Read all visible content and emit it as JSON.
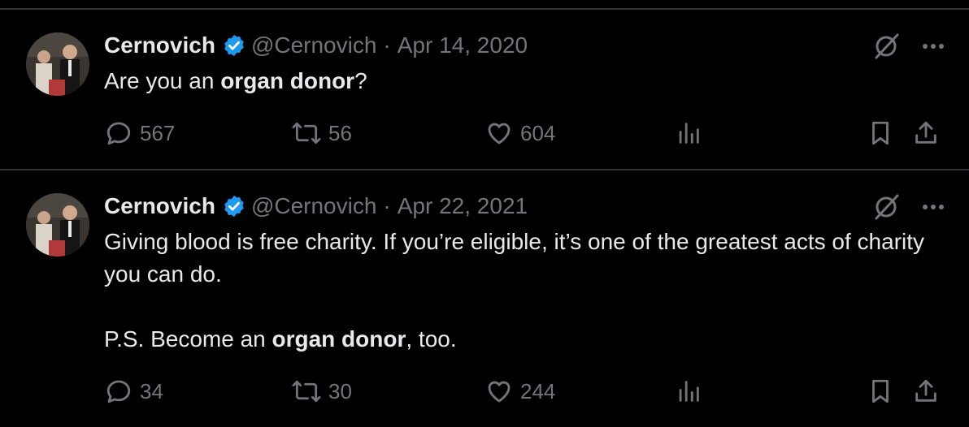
{
  "tweets": [
    {
      "author": "Cernovich",
      "handle": "@Cernovich",
      "separator": "·",
      "date": "Apr 14, 2020",
      "text_parts": [
        [
          {
            "t": "Are you an "
          },
          {
            "t": "organ donor",
            "b": true
          },
          {
            "t": "?"
          }
        ]
      ],
      "replies": "567",
      "reposts": "56",
      "likes": "604"
    },
    {
      "author": "Cernovich",
      "handle": "@Cernovich",
      "separator": "·",
      "date": "Apr 22, 2021",
      "text_parts": [
        [
          {
            "t": "Giving blood is free charity. If you’re eligible, it’s one of the greatest acts of charity you can do."
          }
        ],
        [
          {
            "t": "P.S. Become an "
          },
          {
            "t": "organ donor",
            "b": true
          },
          {
            "t": ", too."
          }
        ]
      ],
      "replies": "34",
      "reposts": "30",
      "likes": "244"
    }
  ],
  "colors": {
    "background": "#000000",
    "text": "#e7e9ea",
    "muted": "#71767b",
    "verified": "#1d9bf0",
    "divider": "#2f3336"
  },
  "icons": [
    "verified-badge-icon",
    "grok-icon",
    "more-icon",
    "reply-icon",
    "repost-icon",
    "like-icon",
    "views-icon",
    "bookmark-icon",
    "share-icon"
  ]
}
